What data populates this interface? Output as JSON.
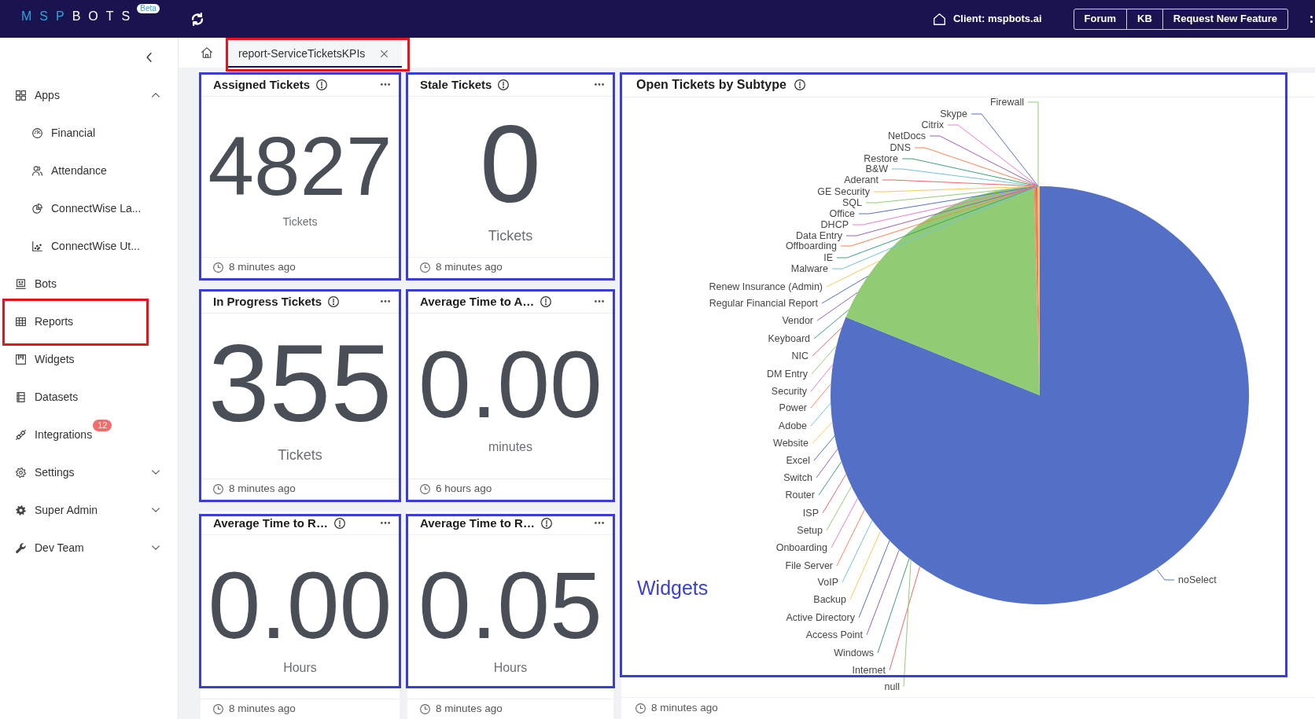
{
  "top_bar": {
    "brand": {
      "name_prefix": "MSP",
      "name_rest": "BOTS",
      "badge": "Beta"
    },
    "client": "Client: mspbots.ai",
    "links": [
      "Forum",
      "KB",
      "Request New Feature"
    ]
  },
  "sidebar": {
    "items": [
      {
        "label": "Apps",
        "kind": "group",
        "expanded": true,
        "highlighted": false,
        "children": [
          {
            "label": "Financial",
            "highlighted": false
          },
          {
            "label": "Attendance",
            "highlighted": false
          },
          {
            "label": "ConnectWise La...",
            "highlighted": false
          },
          {
            "label": "ConnectWise Ut...",
            "highlighted": false
          }
        ]
      },
      {
        "label": "Bots",
        "kind": "link",
        "highlighted": false
      },
      {
        "label": "Reports",
        "kind": "link",
        "highlighted": true
      },
      {
        "label": "Widgets",
        "kind": "link",
        "highlighted": false
      },
      {
        "label": "Datasets",
        "kind": "link",
        "highlighted": false
      },
      {
        "label": "Integrations",
        "kind": "link",
        "highlighted": false,
        "badge": "12"
      },
      {
        "label": "Settings",
        "kind": "group",
        "expanded": false,
        "highlighted": false
      },
      {
        "label": "Super Admin",
        "kind": "group",
        "expanded": false,
        "highlighted": false
      },
      {
        "label": "Dev Team",
        "kind": "group",
        "expanded": false,
        "highlighted": false
      }
    ]
  },
  "tabs": [
    {
      "label": "report-ServiceTicketsKPIs",
      "selected": true,
      "highlighted": true
    }
  ],
  "cards": [
    {
      "title": "Assigned Tickets",
      "value": "4827",
      "unit": "Tickets",
      "updated": "8 minutes ago",
      "highlighted": true,
      "frame_includes_footer": true
    },
    {
      "title": "Stale Tickets",
      "value": "0",
      "unit": "Tickets",
      "updated": "8 minutes ago",
      "highlighted": true,
      "frame_includes_footer": true
    },
    {
      "title": "In Progress Tickets",
      "value": "355",
      "unit": "Tickets",
      "updated": "8 minutes ago",
      "highlighted": true,
      "frame_includes_footer": true
    },
    {
      "title": "Average Time to A…",
      "value": "0.00",
      "unit": "minutes",
      "updated": "6 hours ago",
      "highlighted": true,
      "frame_includes_footer": true
    },
    {
      "title": "Average Time to R…",
      "value": "0.00",
      "unit": "Hours",
      "updated": "8 minutes ago",
      "highlighted": true,
      "frame_includes_footer": false
    },
    {
      "title": "Average Time to R…",
      "value": "0.05",
      "unit": "Hours",
      "updated": "8 minutes ago",
      "highlighted": true,
      "frame_includes_footer": false
    }
  ],
  "chart_card": {
    "title": "Open Tickets by Subtype",
    "highlighted": true,
    "frame_includes_footer": false,
    "annotation": "Widgets",
    "updated": "8 minutes ago",
    "pie": {
      "labels": [
        "Firewall",
        "Skype",
        "Citrix",
        "NetDocs",
        "DNS",
        "Restore",
        "B&W",
        "Aderant",
        "GE Security",
        "SQL",
        "Office",
        "DHCP",
        "Data Entry",
        "Offboarding",
        "IE",
        "Malware",
        "Renew Insurance (Admin)",
        "Regular Financial Report",
        "Vendor",
        "Keyboard",
        "NIC",
        "DM Entry",
        "Security",
        "Power",
        "Adobe",
        "Website",
        "Excel",
        "Switch",
        "Router",
        "ISP",
        "Setup",
        "Onboarding",
        "File Server",
        "VoIP",
        "Backup",
        "Active Directory",
        "Access Point",
        "Windows",
        "Internet",
        "null",
        "noSelect"
      ]
    }
  }
}
